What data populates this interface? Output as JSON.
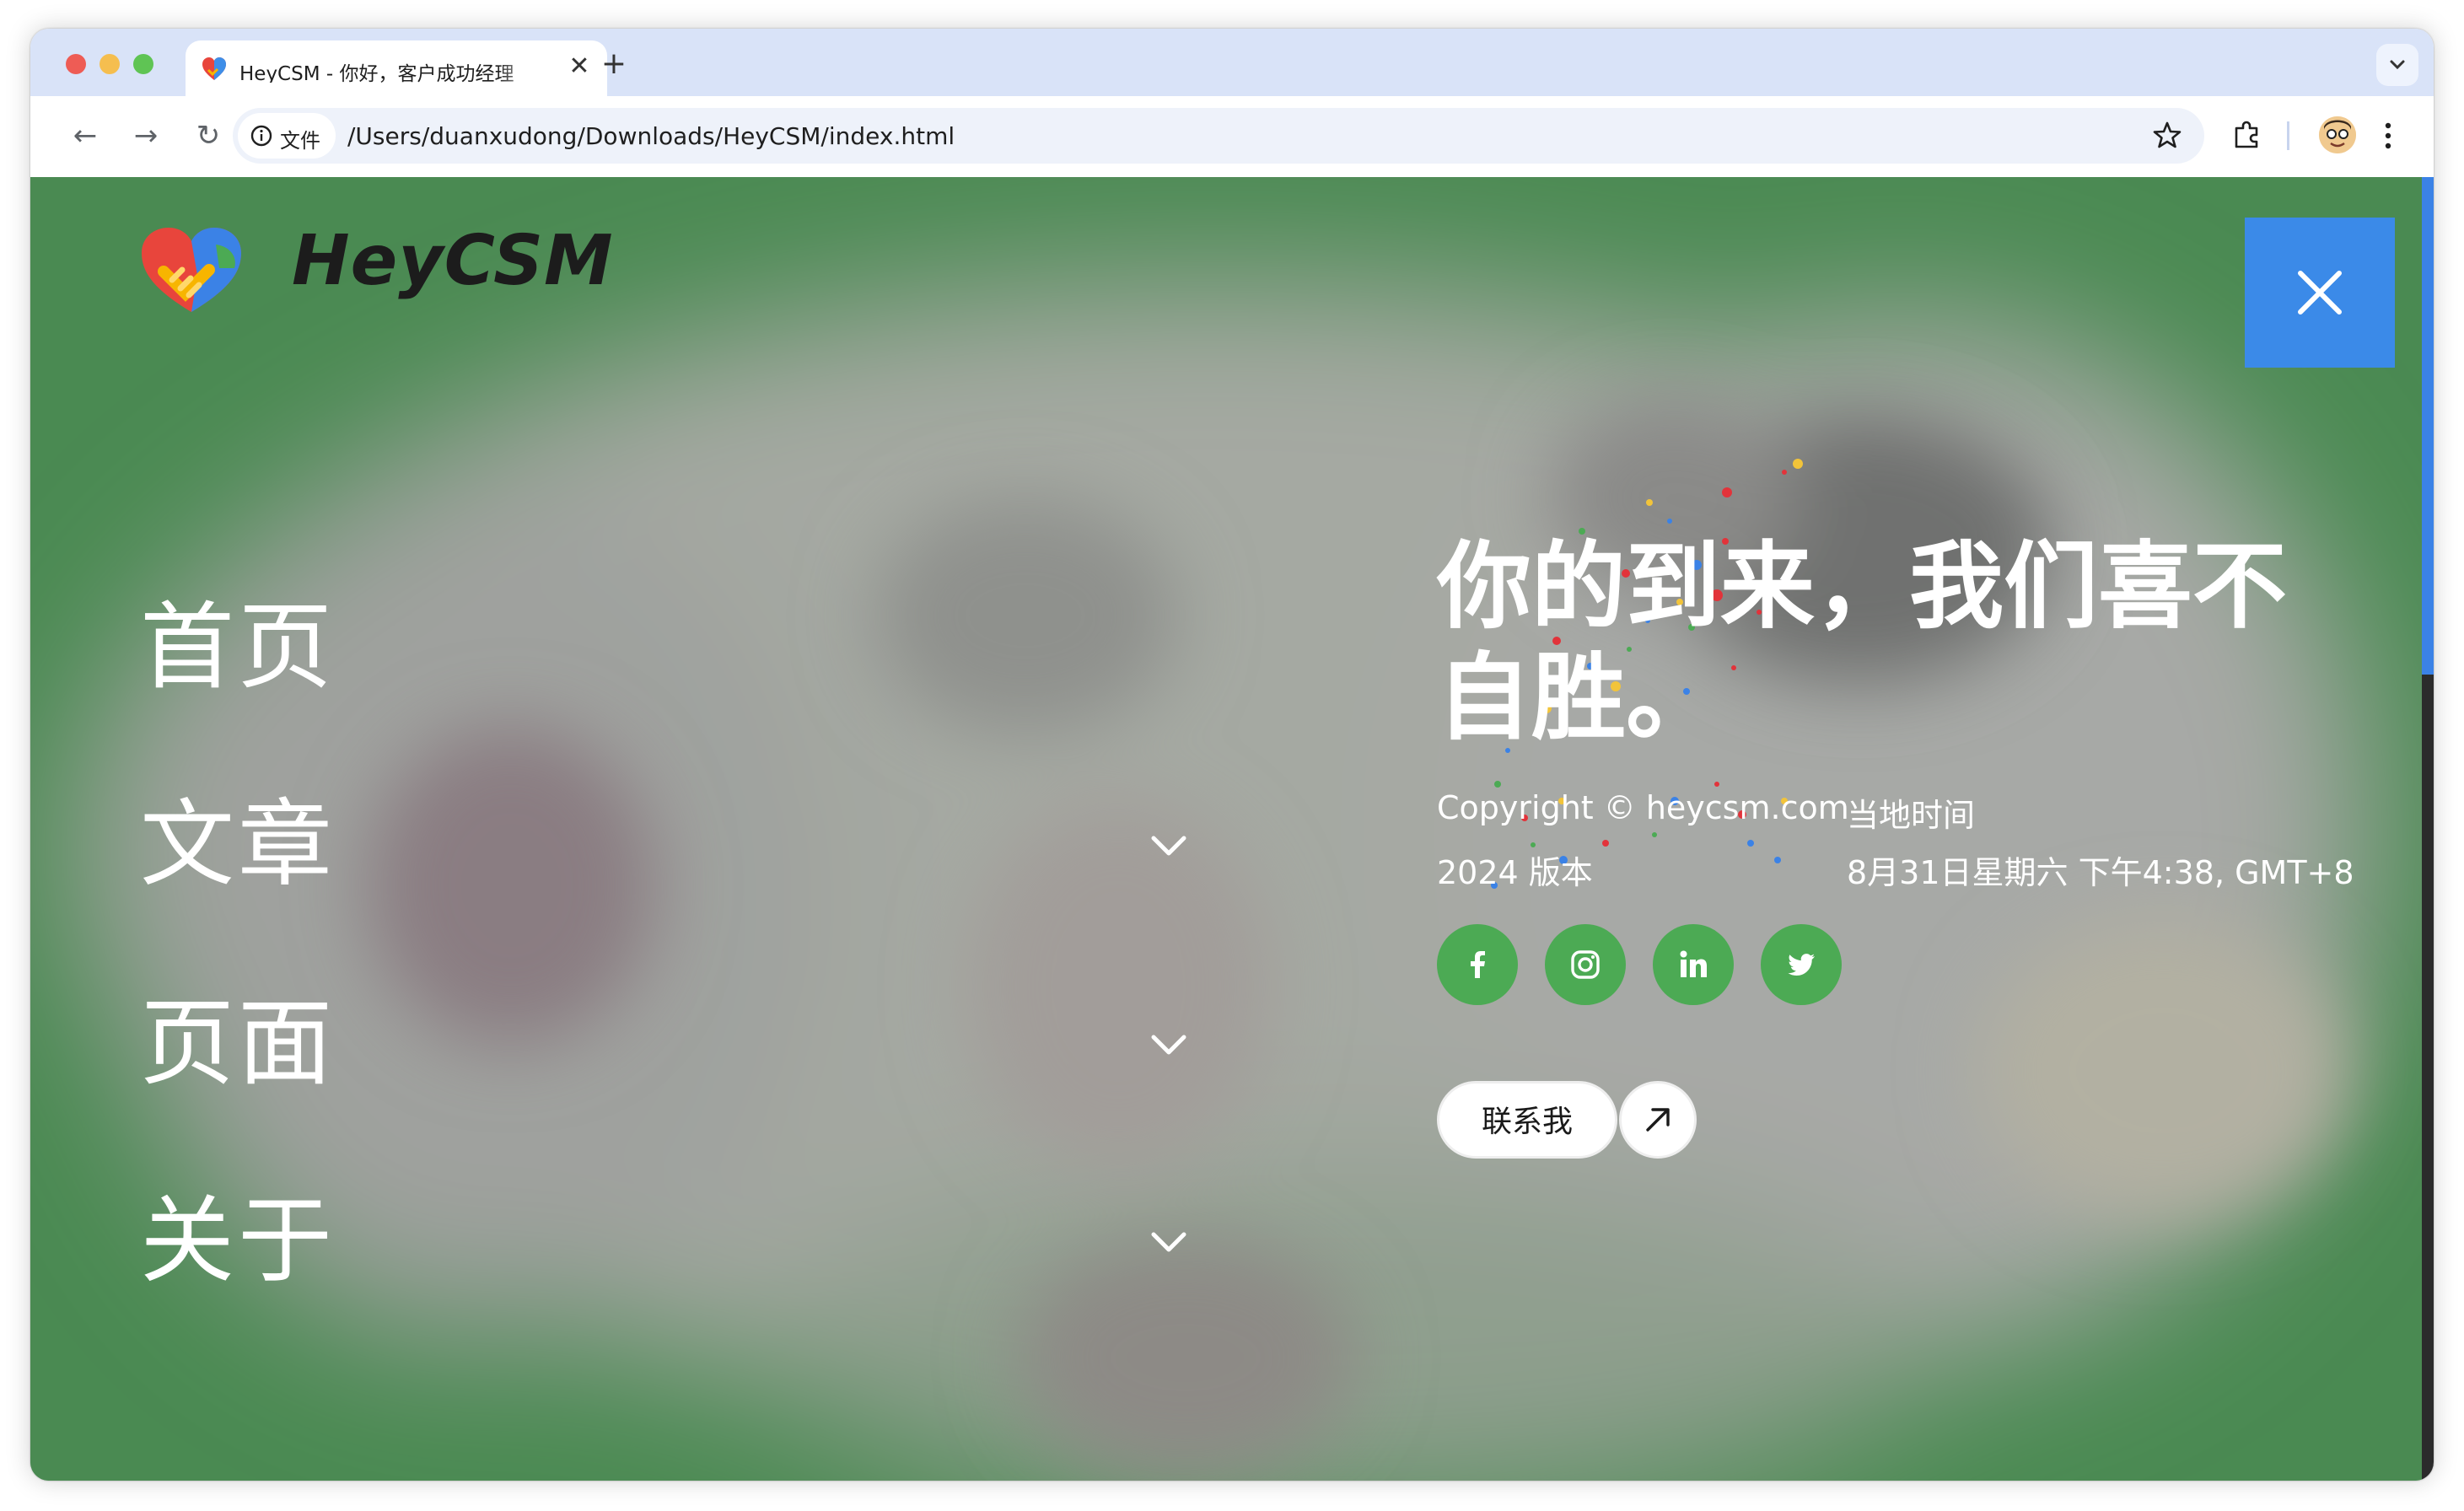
{
  "browser": {
    "tab_title": "HeyCSM - 你好，客户成功经理",
    "tab_close": "✕",
    "new_tab": "+",
    "site_info_label": "文件",
    "url": "/Users/duanxudong/Downloads/HeyCSM/index.html",
    "back": "←",
    "forward": "→",
    "reload": "↻"
  },
  "site": {
    "logo_text": "HeyCSM",
    "menu": [
      {
        "label": "首页",
        "has_submenu": false
      },
      {
        "label": "文章",
        "has_submenu": true
      },
      {
        "label": "页面",
        "has_submenu": true
      },
      {
        "label": "关于",
        "has_submenu": true
      }
    ],
    "headline": "你的到来，我们喜不自胜。",
    "copyright": "Copyright © heycsm.com",
    "version": "2024 版本",
    "local_time_label": "当地时间",
    "local_time_value": "8月31日星期六 下午4:38, GMT+8",
    "social": [
      "facebook-icon",
      "instagram-icon",
      "linkedin-icon",
      "twitter-icon"
    ],
    "contact_label": "联系我"
  },
  "colors": {
    "page_green": "#4d8a55",
    "close_blue": "#3b8ae8",
    "social_green": "#4caa54",
    "tabstrip": "#d9e3f8"
  }
}
